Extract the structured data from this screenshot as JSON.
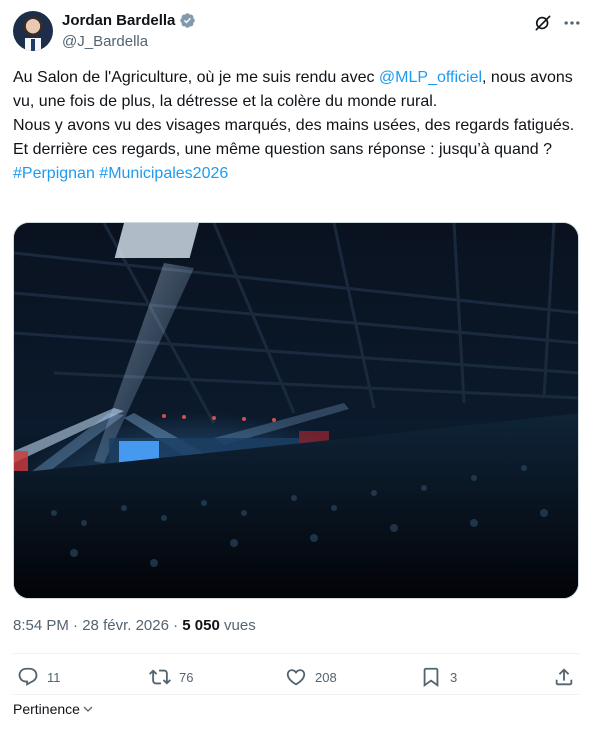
{
  "author": {
    "name": "Jordan Bardella",
    "handle": "@J_Bardella",
    "verified": true,
    "verified_color": "#829aab"
  },
  "tweet": {
    "text_1": "Au Salon de l'Agriculture, où je me suis rendu avec ",
    "mention": "@MLP_officiel",
    "text_2": ", nous avons vu, une fois de plus, la détresse et la colère du monde rural.",
    "text_3": "Nous y avons vu des visages marqués, des mains usées, des regards fatigués.",
    "text_4": "Et derrière ces regards, une même question sans réponse : jusqu’à quand ? ",
    "hashtag_1": "#Perpignan",
    "hashtag_2": "#Municipales2026",
    "link_color": "#1d9bf0"
  },
  "meta": {
    "time": "8:54 PM",
    "dot_1": "·",
    "date": "28 févr. 2026",
    "dot_2": "·",
    "views_count": "5 050",
    "views_label": "vues"
  },
  "actions": {
    "replies": "11",
    "reposts": "76",
    "likes": "208",
    "bookmarks": "3",
    "icons": [
      "reply-icon",
      "repost-icon",
      "like-icon",
      "bookmark-icon",
      "share-icon"
    ]
  },
  "sort": {
    "label": "Pertinence"
  },
  "header_icons": [
    "grok-icon",
    "more-icon"
  ]
}
